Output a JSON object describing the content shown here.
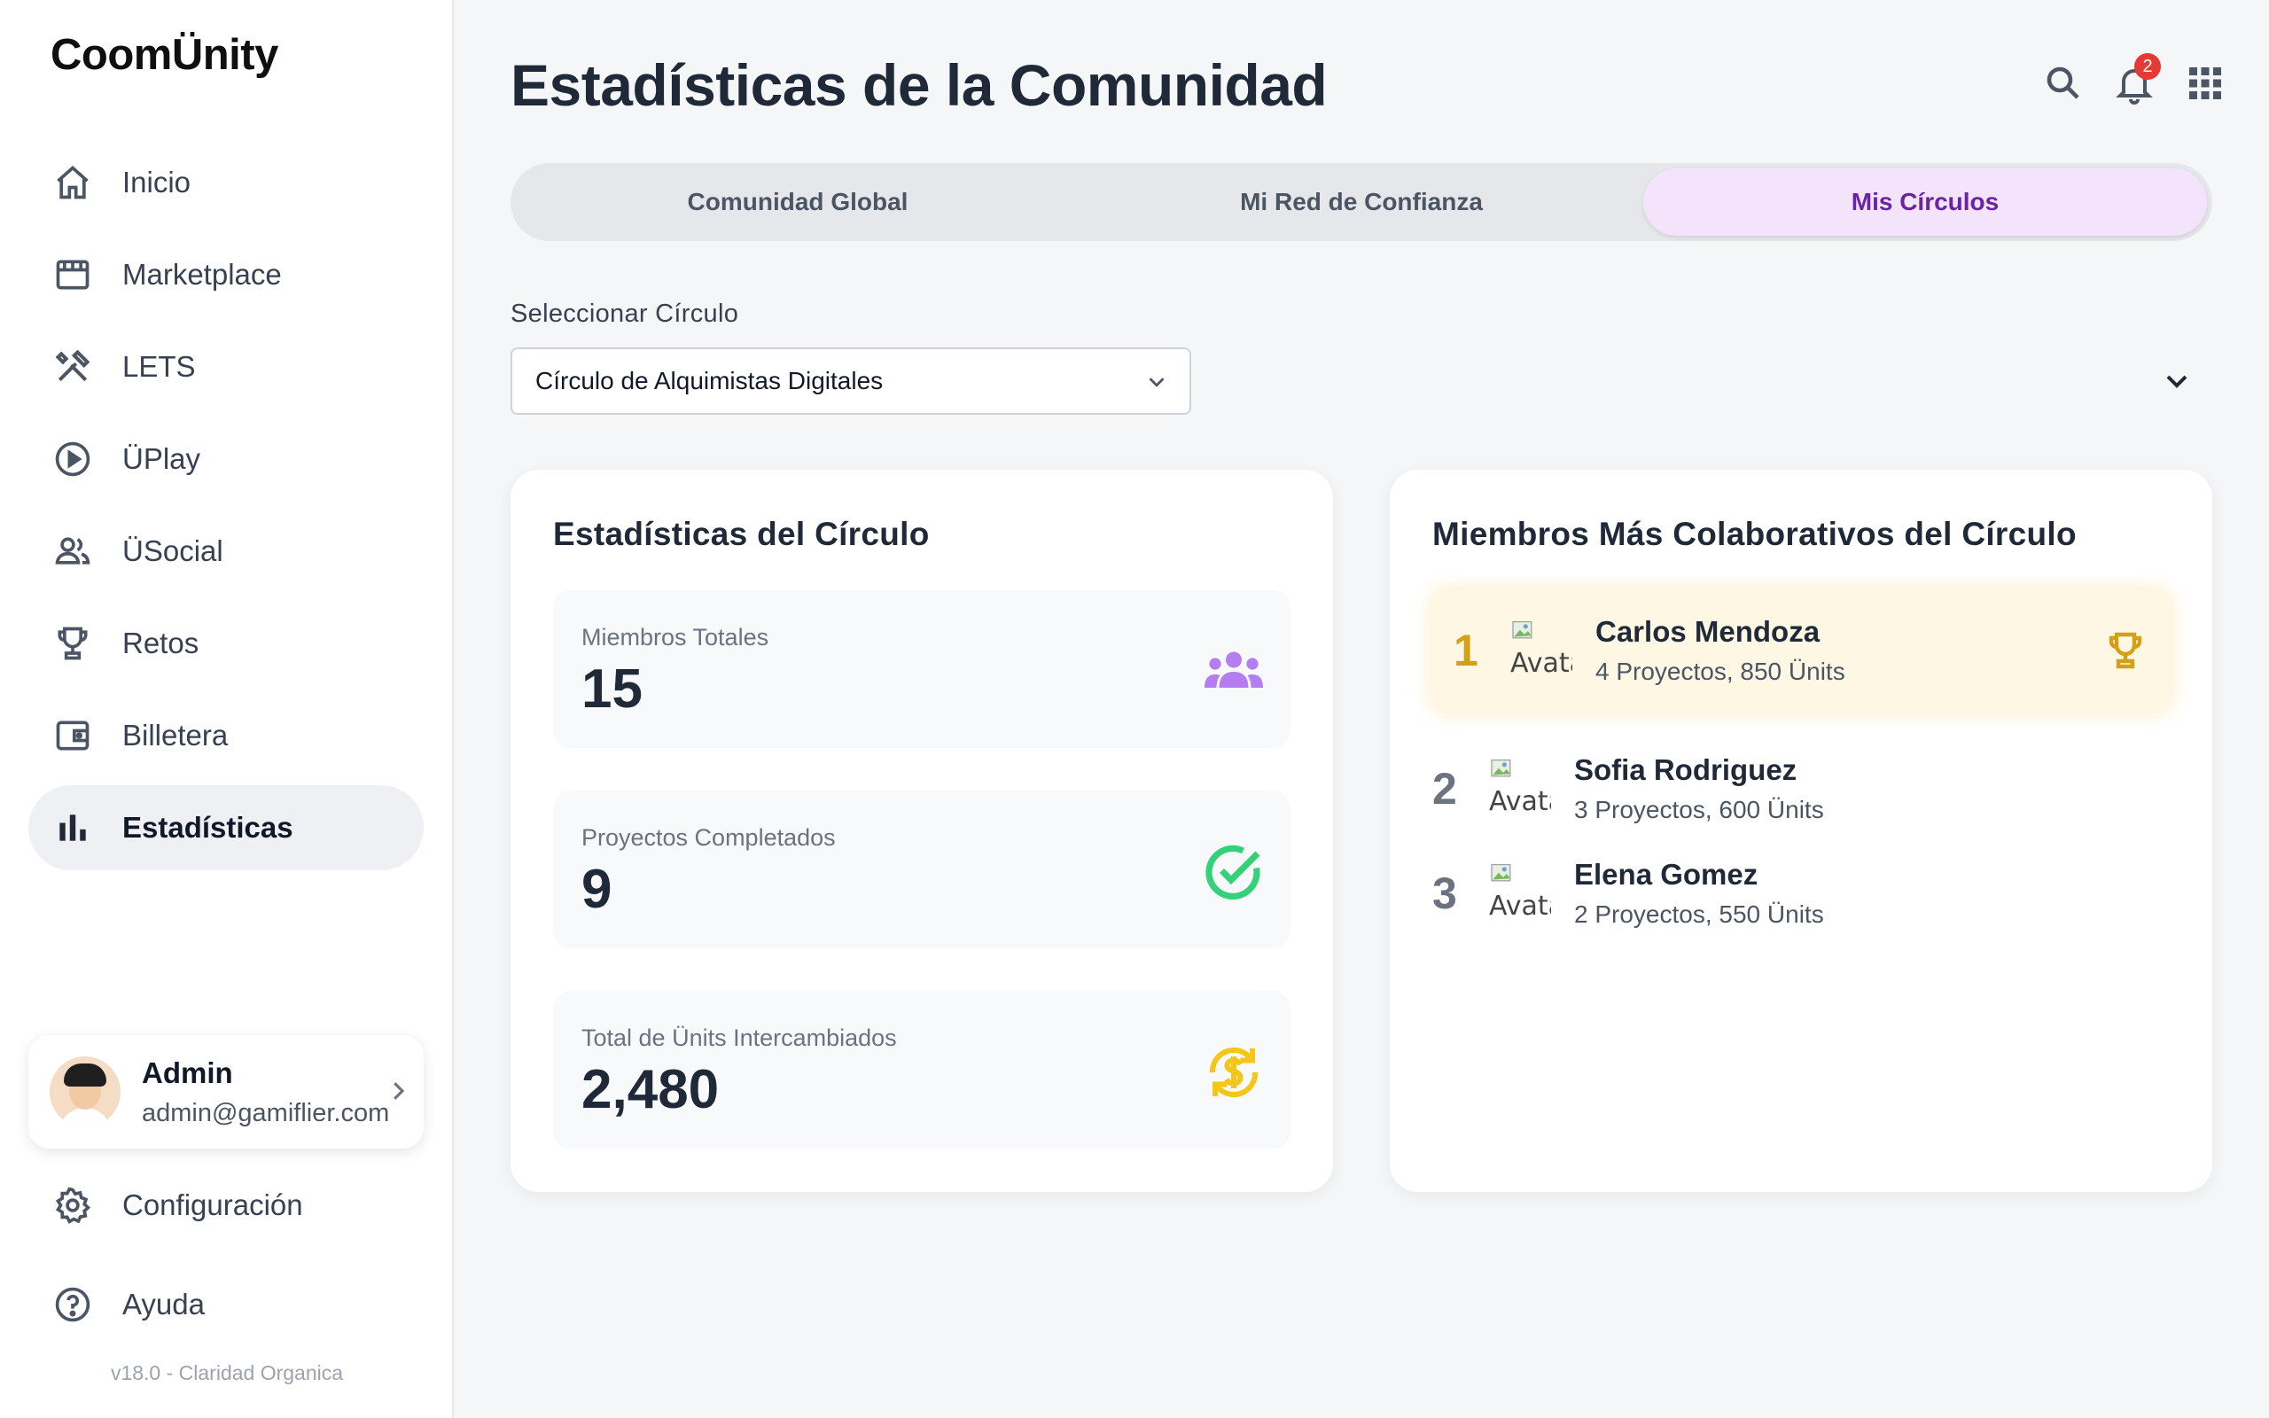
{
  "brand": "CoomÜnity",
  "sidebar": {
    "items": [
      {
        "label": "Inicio",
        "icon": "home-icon"
      },
      {
        "label": "Marketplace",
        "icon": "store-icon"
      },
      {
        "label": "LETS",
        "icon": "tools-icon"
      },
      {
        "label": "ÜPlay",
        "icon": "play-circle-icon"
      },
      {
        "label": "ÜSocial",
        "icon": "people-icon"
      },
      {
        "label": "Retos",
        "icon": "trophy-icon"
      },
      {
        "label": "Billetera",
        "icon": "wallet-icon"
      },
      {
        "label": "Estadísticas",
        "icon": "bar-chart-icon",
        "active": true
      }
    ],
    "user": {
      "name": "Admin",
      "email": "admin@gamiflier.com"
    },
    "bottom_items": [
      {
        "label": "Configuración",
        "icon": "gear-icon"
      },
      {
        "label": "Ayuda",
        "icon": "help-icon"
      }
    ],
    "version": "v18.0 - Claridad Organica"
  },
  "header": {
    "title": "Estadísticas de la Comunidad",
    "notification_count": "2"
  },
  "tabs": [
    {
      "label": "Comunidad Global"
    },
    {
      "label": "Mi Red de Confianza"
    },
    {
      "label": "Mis Círculos",
      "active": true
    }
  ],
  "selector": {
    "label": "Seleccionar Círculo",
    "value": "Círculo de Alquimistas Digitales"
  },
  "circle_stats": {
    "title": "Estadísticas del Círculo",
    "items": [
      {
        "label": "Miembros Totales",
        "value": "15",
        "icon": "group-icon",
        "color": "#b57ef0"
      },
      {
        "label": "Proyectos Completados",
        "value": "9",
        "icon": "check-circle-icon",
        "color": "#34d17a"
      },
      {
        "label": "Total de Ünits Intercambiados",
        "value": "2,480",
        "icon": "currency-exchange-icon",
        "color": "#f5c518"
      }
    ]
  },
  "members": {
    "title": "Miembros Más Colaborativos del Círculo",
    "avatar_alt": "Avatar",
    "list": [
      {
        "rank": "1",
        "name": "Carlos Mendoza",
        "desc": "4 Proyectos, 850 Ünits"
      },
      {
        "rank": "2",
        "name": "Sofia Rodriguez",
        "desc": "3 Proyectos, 600 Ünits"
      },
      {
        "rank": "3",
        "name": "Elena Gomez",
        "desc": "2 Proyectos, 550 Ünits"
      }
    ]
  },
  "colors": {
    "accent": "#6b21a8",
    "gold": "#d4a017",
    "badge": "#e53935"
  }
}
